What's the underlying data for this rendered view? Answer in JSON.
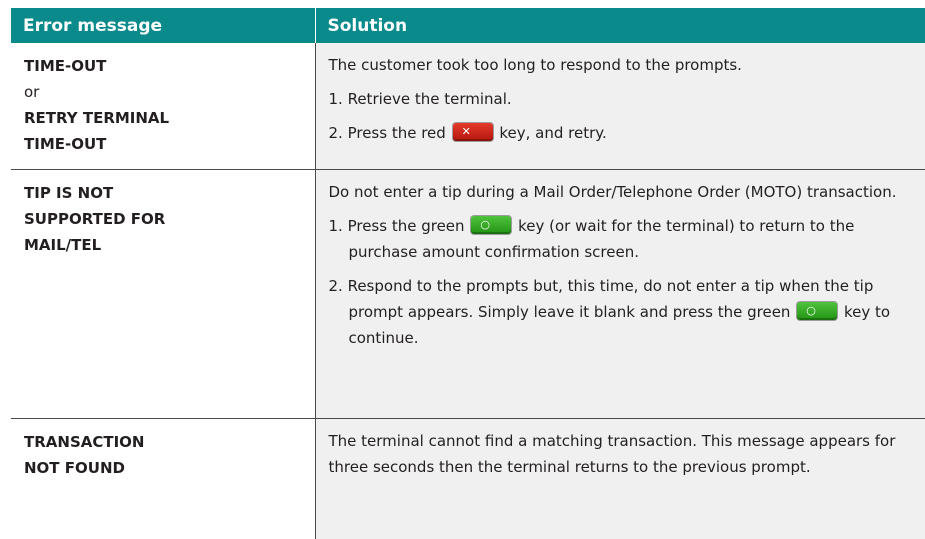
{
  "table": {
    "headers": [
      "Error message",
      "Solution"
    ],
    "header_color": "#0a8a8a",
    "rows": [
      {
        "error_lines": [
          {
            "text": "TIME-OUT",
            "bold": true
          },
          {
            "text": "or",
            "bold": false
          },
          {
            "text": "RETRY TERMINAL",
            "bold": true
          },
          {
            "text": "TIME-OUT",
            "bold": true
          }
        ],
        "solution": {
          "intro": "The customer took too long to respond to the prompts.",
          "step1": "1. Retrieve the terminal.",
          "step2_before": "2. Press the red",
          "step2_after": "key, and retry."
        }
      },
      {
        "error_lines": [
          {
            "text": "TIP IS NOT",
            "bold": true
          },
          {
            "text": "SUPPORTED FOR",
            "bold": true
          },
          {
            "text": "MAIL/TEL",
            "bold": true
          }
        ],
        "solution": {
          "intro": "Do not enter a tip during a Mail Order/Telephone Order (MOTO) transaction.",
          "step1_before": "1. Press the green",
          "step1_after": "key (or wait for the terminal) to return to the purchase amount confirmation screen.",
          "step2_before": "2. Respond to the prompts but, this time, do not enter a tip when the tip prompt appears. Simply leave it blank and press the green",
          "step2_after": "key to continue."
        }
      },
      {
        "error_lines": [
          {
            "text": "TRANSACTION",
            "bold": true
          },
          {
            "text": "NOT FOUND",
            "bold": true
          }
        ],
        "solution": {
          "intro": "The terminal cannot find a matching transaction. This message appears for three seconds then the terminal returns to the previous prompt."
        }
      }
    ],
    "keys": {
      "red_key": {
        "icon": "cancel-key-icon",
        "color": "#d8281c"
      },
      "green_key": {
        "icon": "ok-key-icon",
        "color": "#3aa82a"
      }
    }
  }
}
